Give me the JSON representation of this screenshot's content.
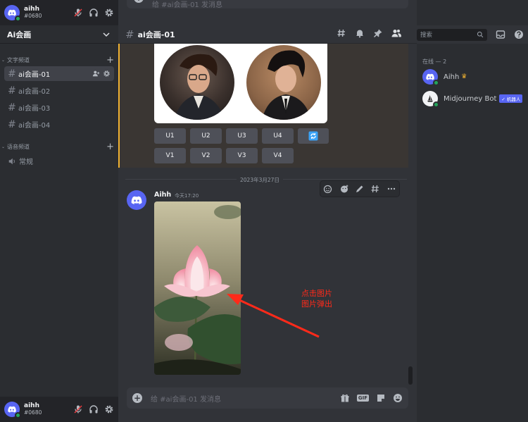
{
  "user": {
    "name": "aihh",
    "tag": "#0680"
  },
  "server": {
    "name": "Ai会画"
  },
  "sidebar": {
    "text_category": "文字频道",
    "channels": [
      {
        "name": "ai会画-01"
      },
      {
        "name": "ai会画-02"
      },
      {
        "name": "ai会画-03"
      },
      {
        "name": "ai会画-04"
      }
    ],
    "voice_category": "语音频道",
    "voice_channels": [
      {
        "name": "常规"
      }
    ]
  },
  "header": {
    "channel": "ai会画-01"
  },
  "top_input": {
    "placeholder": "给 #ai会画-01 发消息"
  },
  "buttons": {
    "upscale": [
      "U1",
      "U2",
      "U3",
      "U4"
    ],
    "variation": [
      "V1",
      "V2",
      "V3",
      "V4"
    ]
  },
  "divider": {
    "date": "2023年3月27日"
  },
  "message": {
    "author": "Aihh",
    "time": "今天17:20"
  },
  "annotation": {
    "line1": "点击图片",
    "line2": "图片弹出"
  },
  "composer": {
    "placeholder": "给 #ai会画-01 发消息",
    "gif": "GIF"
  },
  "right_panel": {
    "search_placeholder": "搜索",
    "online_label": "在线 — 2",
    "members": [
      {
        "name": "Aihh"
      },
      {
        "name": "Midjourney Bot",
        "badge": "✓ 机器人"
      }
    ]
  },
  "colors": {
    "accent": "#5865f2",
    "online": "#23a55a",
    "annotation": "#ff2a1a",
    "highlight_bar": "#f0b232"
  }
}
